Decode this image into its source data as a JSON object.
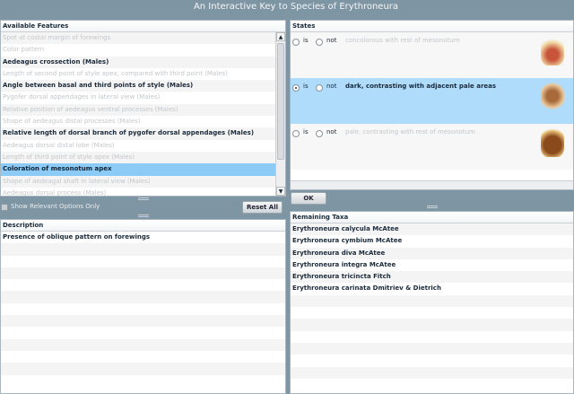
{
  "title": "An Interactive Key to Species of Erythroneura",
  "features": {
    "header": "Available Features",
    "items": [
      {
        "label": "Spot at costal margin of forewings",
        "state": "dim"
      },
      {
        "label": "Color pattern",
        "state": "dim"
      },
      {
        "label": "Aedeagus crossection (Males)",
        "state": "bold"
      },
      {
        "label": "Length of second point of style apex, compared with third point (Males)",
        "state": "dim"
      },
      {
        "label": "Angle between basal and third points of style (Males)",
        "state": "bold"
      },
      {
        "label": "Pygofer dorsal appendages in lateral view (Males)",
        "state": "dim"
      },
      {
        "label": "Relative position of aedeagus ventral processes (Males)",
        "state": "dim"
      },
      {
        "label": "Shape of aedeagus distal processes (Males)",
        "state": "dim"
      },
      {
        "label": "Relative length of dorsal branch of pygofer dorsal appendages (Males)",
        "state": "bold"
      },
      {
        "label": "Aedeagus dorsal distal lobe (Males)",
        "state": "dim"
      },
      {
        "label": "Length of third point of style apex (Males)",
        "state": "dim"
      },
      {
        "label": "Coloration of mesonotum apex",
        "state": "selected"
      },
      {
        "label": "Shape of aedeagal shaft in lateral view (Males)",
        "state": "dim"
      },
      {
        "label": "Aedeagus dorsal process (Males)",
        "state": "dim"
      }
    ]
  },
  "show_relevant_label": "Show Relevant Options Only",
  "reset_label": "Reset All",
  "description": {
    "header": "Description",
    "text": "Presence of oblique pattern on forewings"
  },
  "states": {
    "header": "States",
    "is_label": "is",
    "not_label": "not",
    "items": [
      {
        "label": "concolorous with rest of mesonotum",
        "selected": false
      },
      {
        "label": "dark, contrasting with adjacent pale areas",
        "selected": true
      },
      {
        "label": "pale, contrasting with rest of mesonotum",
        "selected": false
      }
    ]
  },
  "ok_label": "OK",
  "taxa": {
    "header": "Remaining Taxa",
    "items": [
      "Erythroneura calycula McAtee",
      "Erythroneura cymbium McAtee",
      "Erythroneura diva McAtee",
      "Erythroneura integra McAtee",
      "Erythroneura tricincta Fitch",
      "Erythroneura carinata Dmitriev & Dietrich"
    ]
  }
}
